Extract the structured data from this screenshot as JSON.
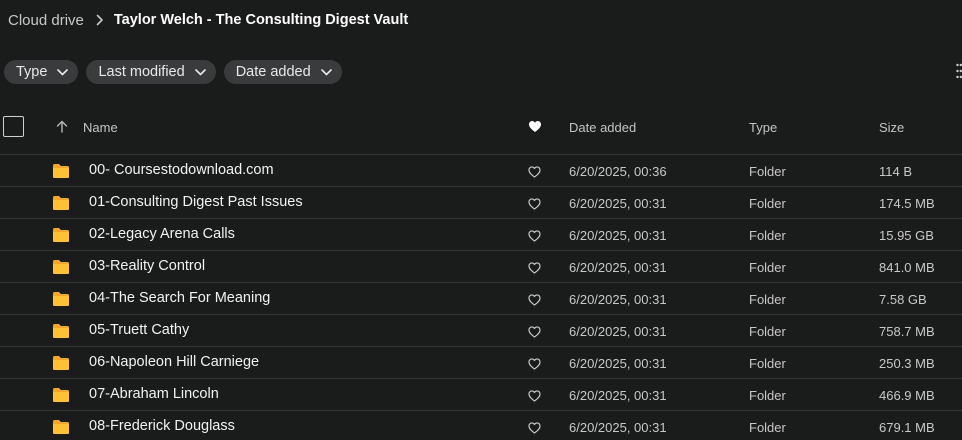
{
  "breadcrumb": {
    "root": "Cloud drive",
    "current": "Taylor Welch - The Consulting Digest Vault"
  },
  "filters": [
    {
      "label": "Type"
    },
    {
      "label": "Last modified"
    },
    {
      "label": "Date added"
    }
  ],
  "table": {
    "columns": {
      "name": "Name",
      "date_added": "Date added",
      "type": "Type",
      "size": "Size"
    },
    "sort": "ascending",
    "rows": [
      {
        "name": "00- Coursestodownload.com",
        "date_added": "6/20/2025, 00:36",
        "type": "Folder",
        "size": "114 B"
      },
      {
        "name": "01-Consulting Digest Past Issues",
        "date_added": "6/20/2025, 00:31",
        "type": "Folder",
        "size": "174.5 MB"
      },
      {
        "name": "02-Legacy Arena Calls",
        "date_added": "6/20/2025, 00:31",
        "type": "Folder",
        "size": "15.95 GB"
      },
      {
        "name": "03-Reality Control",
        "date_added": "6/20/2025, 00:31",
        "type": "Folder",
        "size": "841.0 MB"
      },
      {
        "name": "04-The Search For Meaning",
        "date_added": "6/20/2025, 00:31",
        "type": "Folder",
        "size": "7.58 GB"
      },
      {
        "name": "05-Truett Cathy",
        "date_added": "6/20/2025, 00:31",
        "type": "Folder",
        "size": "758.7 MB"
      },
      {
        "name": "06-Napoleon Hill Carniege",
        "date_added": "6/20/2025, 00:31",
        "type": "Folder",
        "size": "250.3 MB"
      },
      {
        "name": "07-Abraham Lincoln",
        "date_added": "6/20/2025, 00:31",
        "type": "Folder",
        "size": "466.9 MB"
      },
      {
        "name": "08-Frederick Douglass",
        "date_added": "6/20/2025, 00:31",
        "type": "Folder",
        "size": "679.1 MB"
      }
    ]
  },
  "icons": {
    "folder": "folder-icon",
    "favorite": "heart-icon",
    "sort": "arrow-up-icon",
    "chevron": "chevron-down-icon",
    "separator": "chevron-right-icon"
  },
  "colors": {
    "background": "#1a1b1b",
    "chip": "#3a3b3c",
    "folder": "#f5a623",
    "divider": "#343535"
  }
}
